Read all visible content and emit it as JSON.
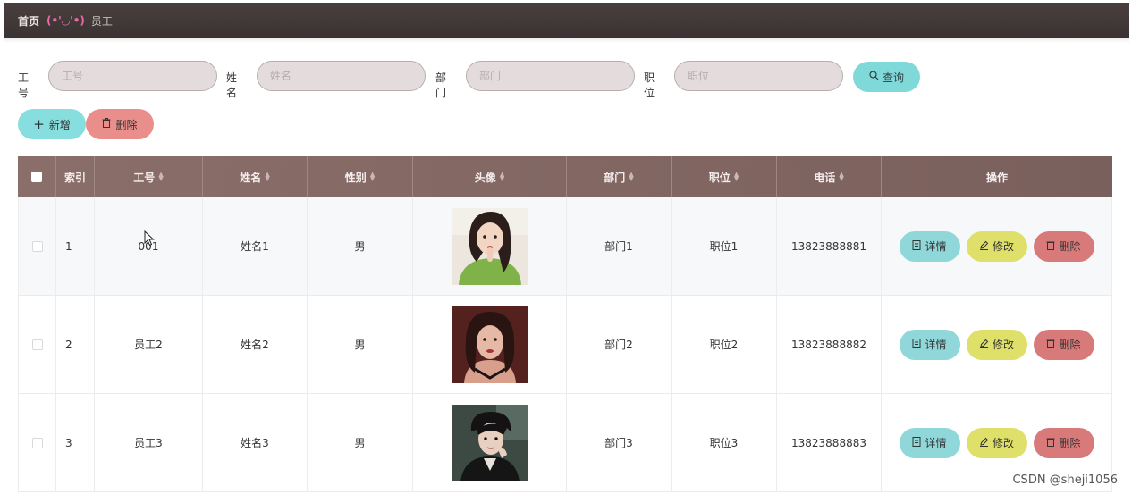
{
  "breadcrumb": {
    "home": "首页",
    "face": "(•'◡'•)",
    "current": "员工"
  },
  "search": {
    "fields": [
      {
        "label": "工号",
        "placeholder": "工号"
      },
      {
        "label": "姓名",
        "placeholder": "姓名"
      },
      {
        "label": "部门",
        "placeholder": "部门"
      },
      {
        "label": "职位",
        "placeholder": "职位"
      }
    ],
    "query_label": "查询"
  },
  "actions": {
    "add_label": "新增",
    "delete_label": "删除"
  },
  "table": {
    "headers": [
      "索引",
      "工号",
      "姓名",
      "性别",
      "头像",
      "部门",
      "职位",
      "电话",
      "操作"
    ],
    "rows": [
      {
        "index": "1",
        "id": "001",
        "name": "姓名1",
        "gender": "男",
        "dept": "部门1",
        "position": "职位1",
        "phone": "13823888881"
      },
      {
        "index": "2",
        "id": "员工2",
        "name": "姓名2",
        "gender": "男",
        "dept": "部门2",
        "position": "职位2",
        "phone": "13823888882"
      },
      {
        "index": "3",
        "id": "员工3",
        "name": "姓名3",
        "gender": "男",
        "dept": "部门3",
        "position": "职位3",
        "phone": "13823888883"
      }
    ],
    "row_actions": {
      "detail": "详情",
      "edit": "修改",
      "delete": "删除"
    }
  },
  "watermark": "CSDN @sheji1056",
  "colors": {
    "query": "#7fd9d9",
    "add": "#86dede",
    "delete": "#e98e8a",
    "edit": "#dfe06a",
    "header": "#8a6e6a"
  }
}
